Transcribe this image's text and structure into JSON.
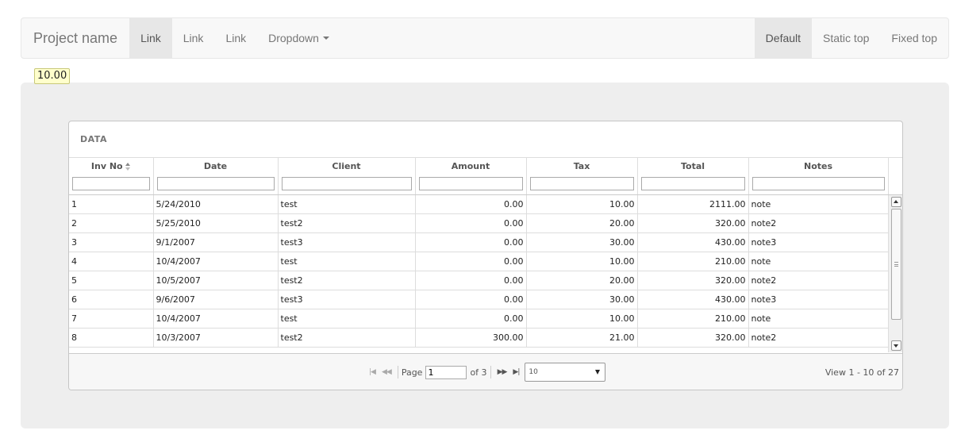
{
  "navbar": {
    "brand": "Project name",
    "left_items": [
      {
        "label": "Link",
        "active": true
      },
      {
        "label": "Link",
        "active": false
      },
      {
        "label": "Link",
        "active": false
      }
    ],
    "dropdown_label": "Dropdown",
    "right_items": [
      {
        "label": "Default",
        "active": true
      },
      {
        "label": "Static top",
        "active": false
      },
      {
        "label": "Fixed top",
        "active": false
      }
    ]
  },
  "badge": {
    "value": "10.00"
  },
  "grid": {
    "caption": "DATA",
    "columns": [
      "Inv No",
      "Date",
      "Client",
      "Amount",
      "Tax",
      "Total",
      "Notes"
    ],
    "sorted_column": "Inv No",
    "rows": [
      {
        "id": "1",
        "date": "5/24/2010",
        "client": "test",
        "amount": "0.00",
        "tax": "10.00",
        "total": "2111.00",
        "note": "note"
      },
      {
        "id": "2",
        "date": "5/25/2010",
        "client": "test2",
        "amount": "0.00",
        "tax": "20.00",
        "total": "320.00",
        "note": "note2"
      },
      {
        "id": "3",
        "date": "9/1/2007",
        "client": "test3",
        "amount": "0.00",
        "tax": "30.00",
        "total": "430.00",
        "note": "note3"
      },
      {
        "id": "4",
        "date": "10/4/2007",
        "client": "test",
        "amount": "0.00",
        "tax": "10.00",
        "total": "210.00",
        "note": "note"
      },
      {
        "id": "5",
        "date": "10/5/2007",
        "client": "test2",
        "amount": "0.00",
        "tax": "20.00",
        "total": "320.00",
        "note": "note2"
      },
      {
        "id": "6",
        "date": "9/6/2007",
        "client": "test3",
        "amount": "0.00",
        "tax": "30.00",
        "total": "430.00",
        "note": "note3"
      },
      {
        "id": "7",
        "date": "10/4/2007",
        "client": "test",
        "amount": "0.00",
        "tax": "10.00",
        "total": "210.00",
        "note": "note"
      },
      {
        "id": "8",
        "date": "10/3/2007",
        "client": "test2",
        "amount": "300.00",
        "tax": "21.00",
        "total": "320.00",
        "note": "note2"
      }
    ]
  },
  "pager": {
    "page_label": "Page",
    "page_value": "1",
    "of_label": "of 3",
    "rows_per_page": "10",
    "view_info": "View 1 - 10 of 27"
  },
  "icons": {
    "first": "first-page-icon",
    "prev": "prev-page-icon",
    "next": "next-page-icon",
    "last": "last-page-icon",
    "sort": "sort-icon"
  }
}
